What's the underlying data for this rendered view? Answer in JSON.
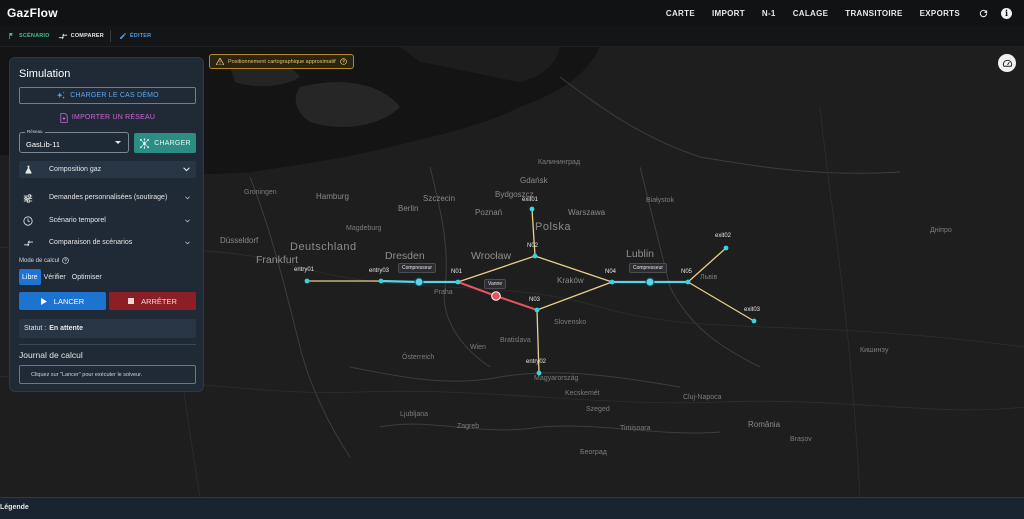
{
  "app": {
    "title": "GazFlow"
  },
  "nav": {
    "items": [
      "CARTE",
      "IMPORT",
      "N-1",
      "CALAGE",
      "TRANSITOIRE",
      "EXPORTS"
    ],
    "icons": [
      "refresh-icon",
      "info-icon"
    ]
  },
  "subnav": {
    "scenario": "SCÉNARIO",
    "comparer": "COMPARER",
    "editer": "ÉDITER"
  },
  "map": {
    "warning": "Positionnement cartographique approximatif",
    "countries": [
      "Deutschland",
      "Polska"
    ],
    "cities": {
      "groningen": "Groningen",
      "hamburg": "Hamburg",
      "szczecin": "Szczecin",
      "bydgoszcz": "Bydgoszcz",
      "gdansk": "Gdańsk",
      "kaliningrad": "Калининград",
      "berlin": "Berlin",
      "poznan": "Poznań",
      "warszawa": "Warszawa",
      "bialystok": "Białystok",
      "magdeburg": "Magdeburg",
      "dusseldorf": "Düsseldorf",
      "dresden": "Dresden",
      "wroclaw": "Wrocław",
      "lublin": "Lublin",
      "frankfurt": "Frankfurt",
      "praha": "Praha",
      "krakow": "Kraków",
      "lviv": "Львів",
      "slovensko": "Slovensko",
      "bratislava": "Bratislava",
      "wien": "Wien",
      "osterreich": "Österreich",
      "magyarorszag": "Magyarország",
      "cluj": "Cluj-Napoca",
      "timisoara": "Timișoara",
      "zagreb": "Zagreb",
      "beograd": "Београд",
      "romania": "România",
      "brasov": "Brașov",
      "kishinev": "Кишинэу",
      "kecskemet": "Kecskemét",
      "szeged": "Szeged",
      "ljubljana": "Ljubljana",
      "dnipro": "Дніпро"
    },
    "nodes": {
      "entry01": "entry01",
      "entry03": "entry03",
      "entry02": "entry02",
      "exit01": "exit01",
      "exit02": "exit02",
      "exit03": "exit03",
      "n01": "N01",
      "n02": "N02",
      "n03": "N03",
      "n04": "N04",
      "n05": "N05"
    },
    "tags": {
      "compresseur_left": "Compresseur",
      "compresseur_right": "Compresseur",
      "vanne": "Vanne"
    },
    "colors": {
      "pipe": "#e9cf8c",
      "compressor_link": "#5bd3ea",
      "valve_link": "#e25560",
      "node": "#37d3e0"
    }
  },
  "panel": {
    "title": "Simulation",
    "demo_button": "CHARGER LE CAS DÉMO",
    "import_button": "IMPORTER UN RÉSEAU",
    "network_select": {
      "legend": "Réseau",
      "value": "GasLib-11"
    },
    "charger_button": "CHARGER",
    "accordions": [
      {
        "label": "Composition gaz",
        "icon": "flask-icon"
      },
      {
        "label": "Demandes personnalisées (soutirage)",
        "icon": "sliders-icon"
      },
      {
        "label": "Scénario temporel",
        "icon": "clock-icon"
      },
      {
        "label": "Comparaison de scénarios",
        "icon": "compare-icon"
      }
    ],
    "mode": {
      "label": "Mode de calcul",
      "options": [
        "Libre",
        "Vérifier",
        "Optimiser"
      ],
      "selected": "Libre"
    },
    "lancer_button": "LANCER",
    "arreter_button": "ARRÊTER",
    "status": {
      "label": "Statut :",
      "value": "En attente"
    },
    "journal": {
      "title": "Journal de calcul",
      "message": "Cliquez sur \"Lancer\" pour exécuter le solveur."
    }
  },
  "legend": {
    "title": "Légende"
  }
}
